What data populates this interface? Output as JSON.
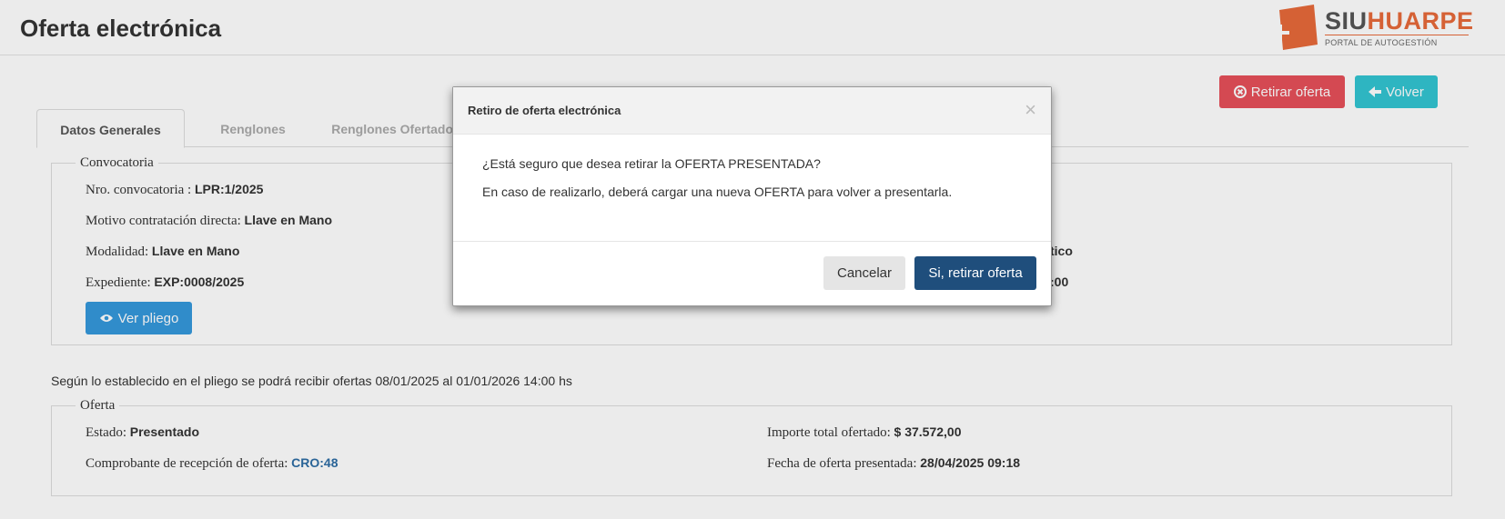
{
  "header": {
    "title": "Oferta electrónica",
    "logo": {
      "siu": "SIU",
      "huarpe": "HUARPE",
      "subtitle": "PORTAL DE AUTOGESTIÓN"
    }
  },
  "actions": {
    "retirar_label": "Retirar oferta",
    "volver_label": "Volver"
  },
  "tabs": [
    {
      "label": "Datos Generales",
      "active": true
    },
    {
      "label": "Renglones",
      "active": false
    },
    {
      "label": "Renglones Ofertados",
      "active": false
    }
  ],
  "convocatoria": {
    "legend": "Convocatoria",
    "nro_label": "Nro. convocatoria :",
    "nro_value": "LPR:1/2025",
    "motivo_label": "Motivo contratación directa:",
    "motivo_value": "Llave en Mano",
    "modalidad_label": "Modalidad:",
    "modalidad_value": "Llave en Mano",
    "expediente_label": "Expediente:",
    "expediente_value": "EXP:0008/2025",
    "right_partial_1": "tico",
    "right_partial_2": ":00",
    "ver_pliego_label": "Ver pliego"
  },
  "plazo_text": "Según lo establecido en el pliego se podrá recibir ofertas 08/01/2025 al 01/01/2026 14:00 hs",
  "oferta": {
    "legend": "Oferta",
    "estado_label": "Estado:",
    "estado_value": "Presentado",
    "comprobante_label": "Comprobante de recepción de oferta:",
    "comprobante_value": "CRO:48",
    "importe_label": "Importe total ofertado:",
    "importe_value": "$ 37.572,00",
    "fecha_label": "Fecha de oferta presentada:",
    "fecha_value": "28/04/2025 09:18"
  },
  "modal": {
    "title": "Retiro de oferta electrónica",
    "close": "×",
    "line1": "¿Está seguro que desea retirar la OFERTA PRESENTADA?",
    "line2": "En caso de realizarlo, deberá cargar una nueva OFERTA para volver a presentarla.",
    "cancel_label": "Cancelar",
    "confirm_label": "Si, retirar oferta"
  },
  "colors": {
    "danger": "#e7505a",
    "info": "#32c5d2",
    "primary": "#3598dc",
    "confirm": "#1f4e7c",
    "brand": "#e86a3a"
  }
}
